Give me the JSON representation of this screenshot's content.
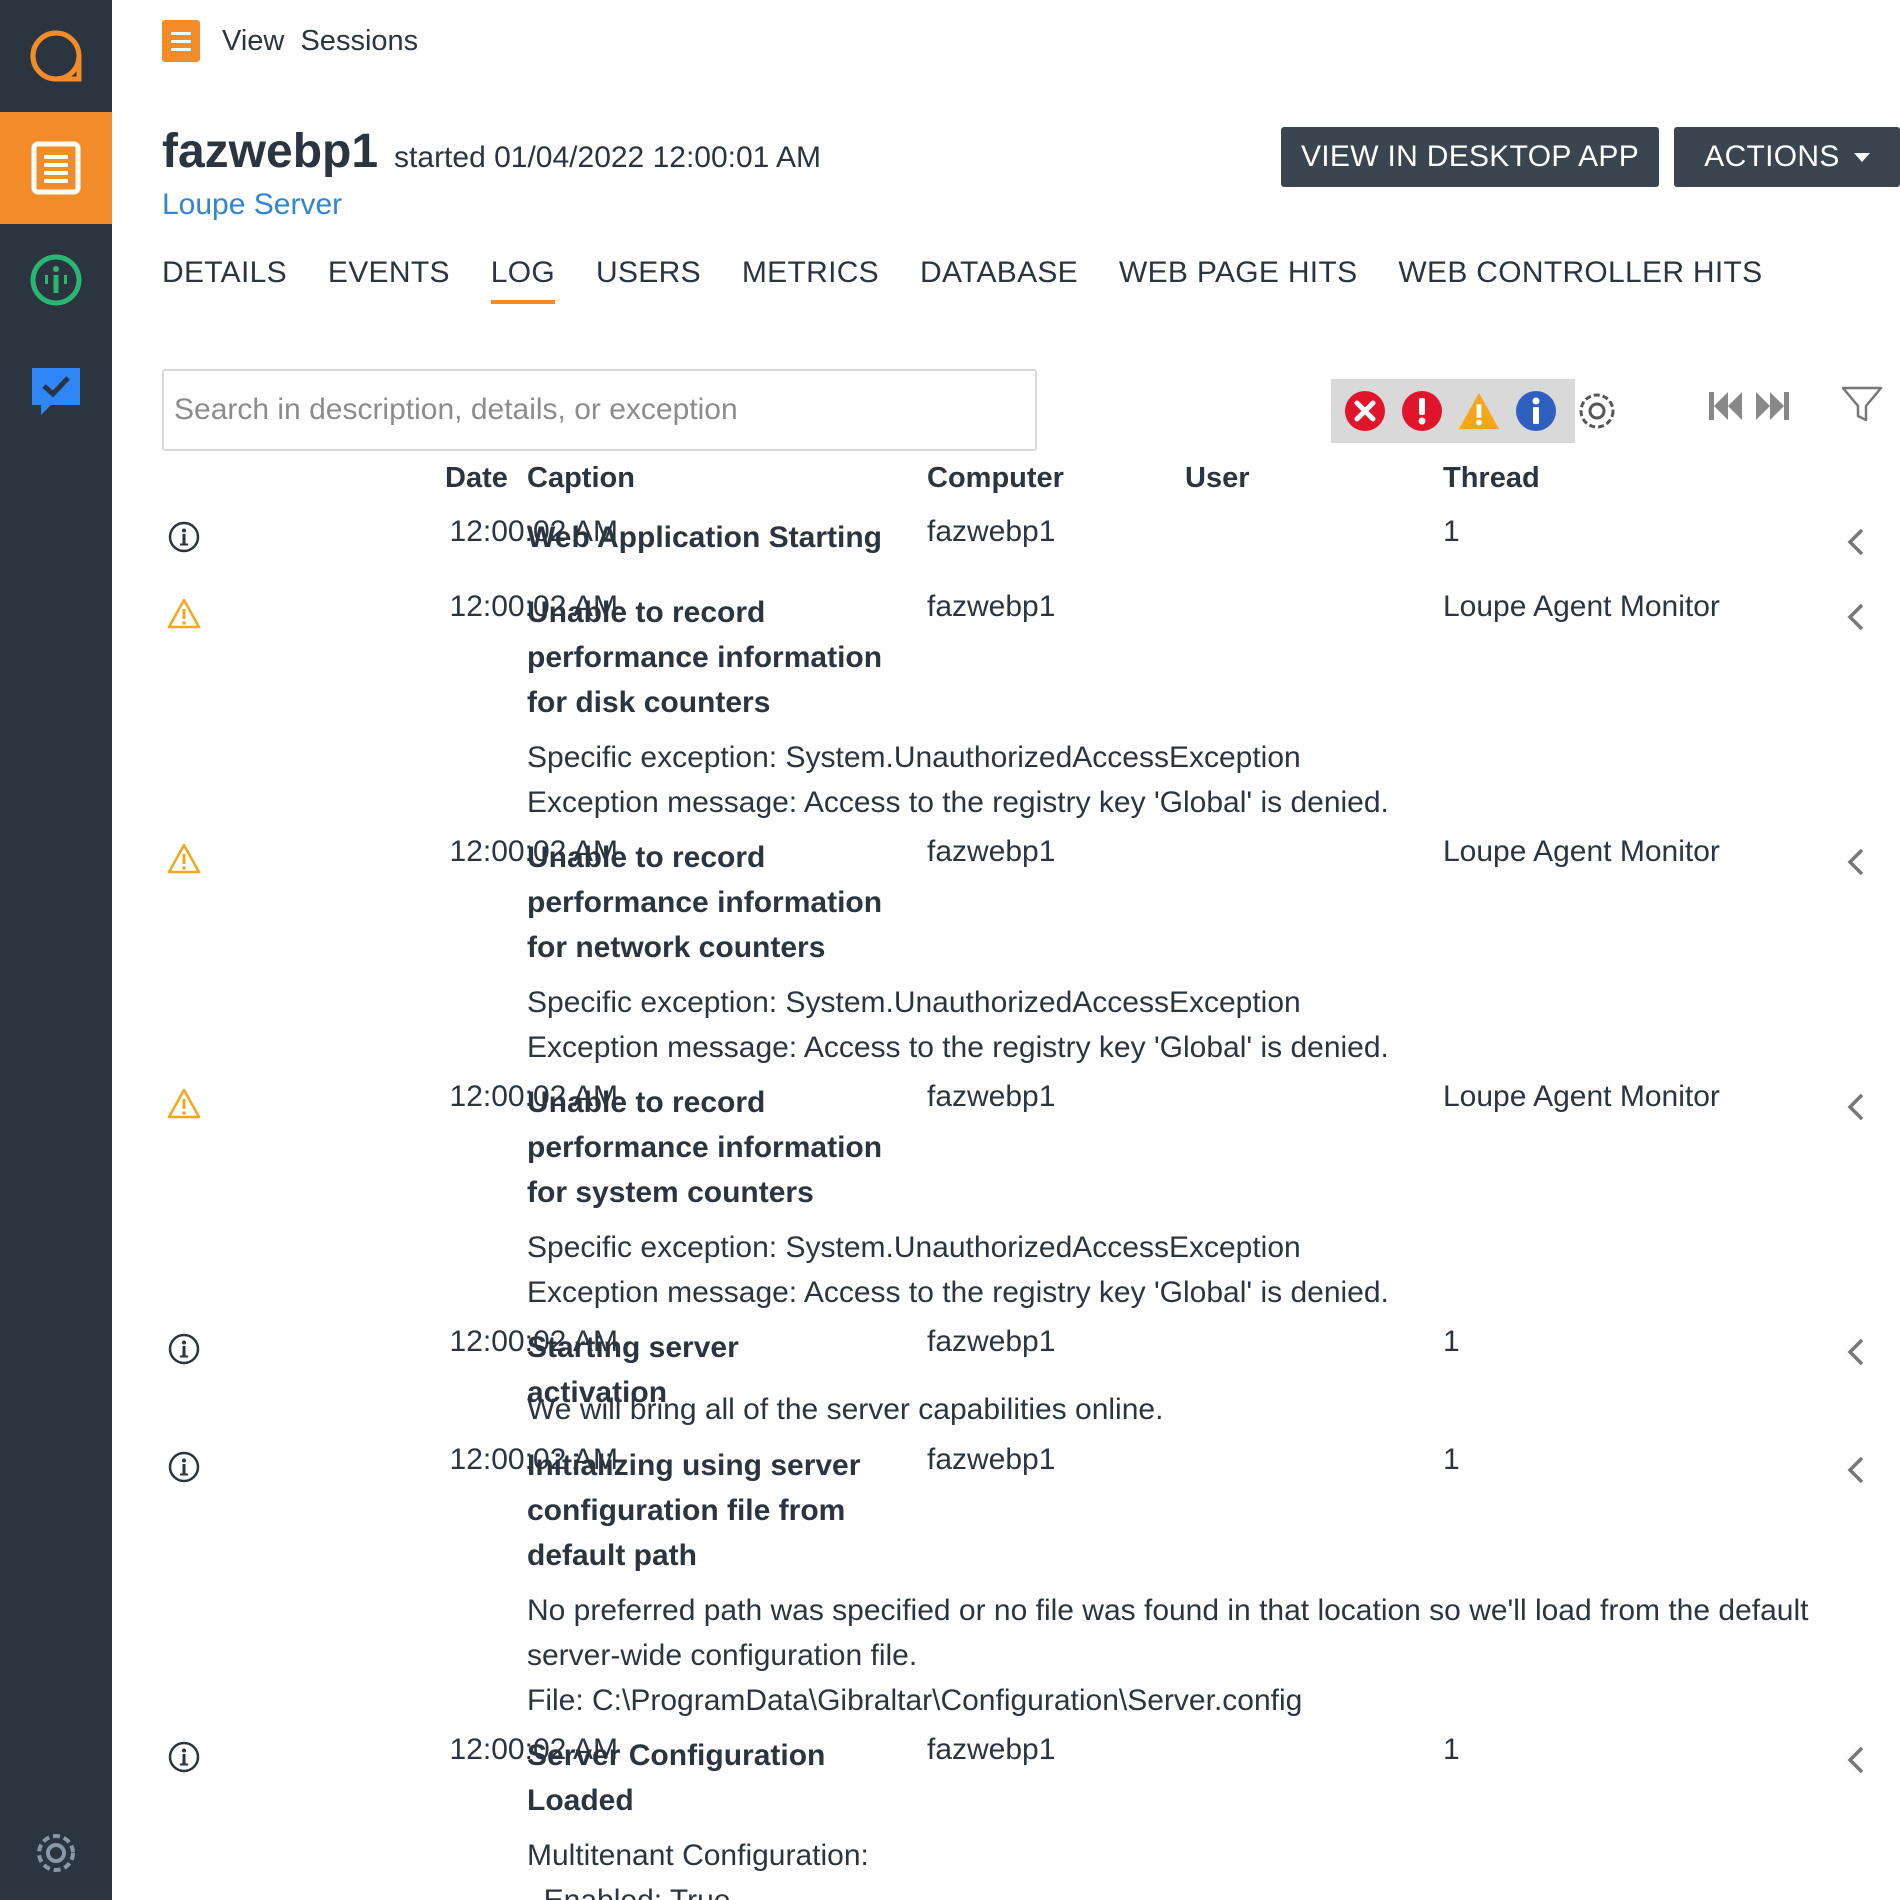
{
  "colors": {
    "sidebar": "#2b3540",
    "accent": "#f28c28",
    "link": "#2f86d6",
    "button": "#3a4550",
    "error": "#e0142b",
    "warning": "#f6a61b",
    "info": "#2f5fbf"
  },
  "sidebar": {
    "items": [
      {
        "name": "loupe-logo-icon"
      },
      {
        "name": "sessions-icon",
        "active": true
      },
      {
        "name": "monitor-icon"
      },
      {
        "name": "issues-icon"
      },
      {
        "name": "settings-icon"
      }
    ]
  },
  "breadcrumb": {
    "view": "View",
    "sessions": "Sessions"
  },
  "header": {
    "title": "fazwebp1",
    "subtitle": "started 01/04/2022 12:00:01 AM",
    "link": "Loupe Server",
    "desktop_button": "VIEW IN DESKTOP APP",
    "actions_button": "ACTIONS"
  },
  "tabs": [
    "DETAILS",
    "EVENTS",
    "LOG",
    "USERS",
    "METRICS",
    "DATABASE",
    "WEB PAGE HITS",
    "WEB CONTROLLER HITS"
  ],
  "active_tab": "LOG",
  "search": {
    "placeholder": "Search in description, details, or exception",
    "value": ""
  },
  "toolbar": {
    "severity_filters": [
      "critical-icon",
      "error-icon",
      "warning-icon",
      "info-icon"
    ],
    "icons": [
      "gear-icon",
      "first-page-icon",
      "last-page-icon",
      "filter-icon"
    ]
  },
  "columns": {
    "date": "Date",
    "caption": "Caption",
    "computer": "Computer",
    "user": "User",
    "thread": "Thread"
  },
  "rows": [
    {
      "severity": "info",
      "date": "12:00:02 AM",
      "caption": "Web Application Starting",
      "computer": "fazwebp1",
      "user": "",
      "thread": "1",
      "details": ""
    },
    {
      "severity": "warning",
      "date": "12:00:02 AM",
      "caption": "Unable to record performance information for disk counters",
      "computer": "fazwebp1",
      "user": "",
      "thread": "Loupe Agent Monitor",
      "details": "Specific exception: System.UnauthorizedAccessException\nException message: Access to the registry key 'Global' is denied."
    },
    {
      "severity": "warning",
      "date": "12:00:02 AM",
      "caption": "Unable to record performance information for network counters",
      "computer": "fazwebp1",
      "user": "",
      "thread": "Loupe Agent Monitor",
      "details": "Specific exception: System.UnauthorizedAccessException\nException message: Access to the registry key 'Global' is denied."
    },
    {
      "severity": "warning",
      "date": "12:00:02 AM",
      "caption": "Unable to record performance information for system counters",
      "computer": "fazwebp1",
      "user": "",
      "thread": "Loupe Agent Monitor",
      "details": "Specific exception: System.UnauthorizedAccessException\nException message: Access to the registry key 'Global' is denied."
    },
    {
      "severity": "info",
      "date": "12:00:02 AM",
      "caption": "Starting server activation",
      "computer": "fazwebp1",
      "user": "",
      "thread": "1",
      "details": "We will bring all of the server capabilities online."
    },
    {
      "severity": "info",
      "date": "12:00:02 AM",
      "caption": "Initializing using server configuration file from default path",
      "computer": "fazwebp1",
      "user": "",
      "thread": "1",
      "details": "No preferred path was specified or no file was found in that location so we'll load from the default\nserver-wide configuration file.\nFile: C:\\ProgramData\\Gibraltar\\Configuration\\Server.config"
    },
    {
      "severity": "info",
      "date": "12:00:02 AM",
      "caption": "Server Configuration Loaded",
      "computer": "fazwebp1",
      "user": "",
      "thread": "1",
      "details": "Multitenant Configuration:\n  Enabled: True"
    }
  ]
}
